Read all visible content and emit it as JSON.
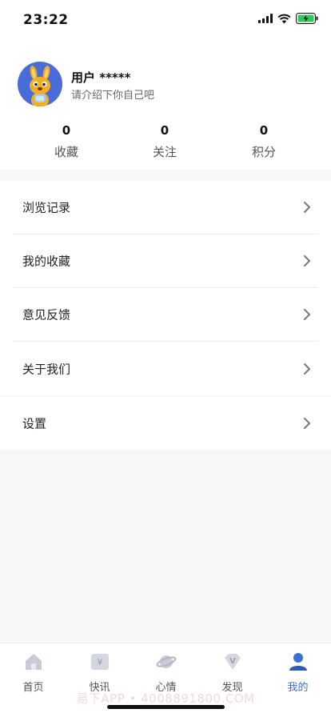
{
  "status_bar": {
    "time": "23:22"
  },
  "profile": {
    "username": "用户 *****",
    "intro": "请介绍下你自己吧"
  },
  "stats": [
    {
      "value": "0",
      "label": "收藏"
    },
    {
      "value": "0",
      "label": "关注"
    },
    {
      "value": "0",
      "label": "积分"
    }
  ],
  "menu": {
    "group1": [
      {
        "label": "浏览记录"
      },
      {
        "label": "我的收藏"
      },
      {
        "label": "意见反馈"
      },
      {
        "label": "关于我们"
      }
    ],
    "group2": [
      {
        "label": "设置"
      }
    ]
  },
  "tabbar": {
    "items": [
      {
        "label": "首页",
        "icon": "home-icon"
      },
      {
        "label": "快讯",
        "icon": "news-icon"
      },
      {
        "label": "心情",
        "icon": "planet-icon"
      },
      {
        "label": "发现",
        "icon": "discover-icon"
      },
      {
        "label": "我的",
        "icon": "profile-icon"
      }
    ],
    "active_index": 4
  },
  "watermark": "易下APP • 4008891800.COM",
  "colors": {
    "accent": "#3d6fd1",
    "avatar_bg": "#4a6cd8",
    "page_bg": "#f7f7f7"
  }
}
